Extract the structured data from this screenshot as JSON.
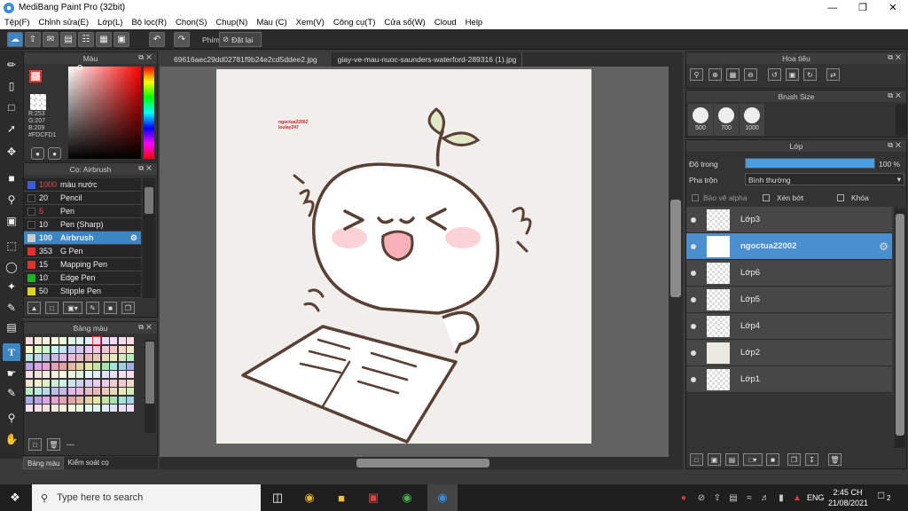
{
  "app": {
    "title": "MediBang Paint Pro (32bit)"
  },
  "menu": [
    "Tệp(F)",
    "Chỉnh sửa(E)",
    "Lớp(L)",
    "Bộ lọc(R)",
    "Chọn(S)",
    "Chụp(N)",
    "Màu (C)",
    "Xem(V)",
    "Công cụ(T)",
    "Cửa sổ(W)",
    "Cloud",
    "Help"
  ],
  "toolbar": {
    "shortcut_label": "Phím",
    "reset_label": "Đặt lại"
  },
  "color_panel": {
    "title": "Màu",
    "rgb_r": "R:253",
    "rgb_g": "G:207",
    "rgb_b": "B:209",
    "hex": "#FDCFD1",
    "primary": "#FDCFD1",
    "secondary": "#ffffff"
  },
  "brush_panel": {
    "title": "Cọ: Airbrush",
    "items": [
      {
        "size": "1000",
        "name": "màu nước",
        "color": "#3b5bdb",
        "size_color": "#e05050"
      },
      {
        "size": "20",
        "name": "Pencil",
        "color": "#222222",
        "size_color": "#eeeeee"
      },
      {
        "size": "5",
        "name": "Pen",
        "color": "#222222",
        "size_color": "#e05050"
      },
      {
        "size": "10",
        "name": "Pen (Sharp)",
        "color": "#222222",
        "size_color": "#eeeeee"
      },
      {
        "size": "100",
        "name": "Airbrush",
        "color": "#cccccc",
        "size_color": "#ffffff"
      },
      {
        "size": "353",
        "name": "G Pen",
        "color": "#e03030",
        "size_color": "#eeeeee"
      },
      {
        "size": "15",
        "name": "Mapping Pen",
        "color": "#e03030",
        "size_color": "#eeeeee"
      },
      {
        "size": "10",
        "name": "Edge Pen",
        "color": "#20b020",
        "size_color": "#eeeeee"
      },
      {
        "size": "50",
        "name": "Stipple Pen",
        "color": "#e0d020",
        "size_color": "#eeeeee"
      }
    ]
  },
  "palette_panel": {
    "title": "Bảng màu",
    "name_field": "---"
  },
  "bottom_tabs": [
    "Bảng màu",
    "Kiểm soát cọ"
  ],
  "tabs": [
    "69616aec29dd02781f9b24e2cd5ddee2.jpg",
    "giay-ve-mau-nuoc-saunders-waterford-289316 (1).jpg"
  ],
  "canvas": {
    "watermark_line1": "ngoctua22002",
    "watermark_line2": "loulay247"
  },
  "navigator": {
    "title": "Hoa tiêu"
  },
  "brush_size": {
    "title": "Brush Size",
    "sizes": [
      "500",
      "700",
      "1000"
    ]
  },
  "layer_panel": {
    "title": "Lớp",
    "opacity_label": "Độ trong",
    "opacity_value": "100 %",
    "opacity": 1.0,
    "blend_label": "Pha trộn",
    "blend_value": "Bình thường",
    "protect_alpha": "Bảo vệ alpha",
    "clipping": "Xén bớt",
    "lock": "Khóa",
    "layers": [
      {
        "name": "Lớp3",
        "selected": false
      },
      {
        "name": "ngoctua22002",
        "selected": true
      },
      {
        "name": "Lớp6",
        "selected": false
      },
      {
        "name": "Lớp5",
        "selected": false
      },
      {
        "name": "Lớp4",
        "selected": false
      },
      {
        "name": "Lớp2",
        "selected": false
      },
      {
        "name": "Lớp1",
        "selected": false
      }
    ]
  },
  "taskbar": {
    "search_placeholder": "Type here to search",
    "language": "ENG",
    "time": "2:45 CH",
    "date": "21/08/2021",
    "notifications": "2"
  }
}
